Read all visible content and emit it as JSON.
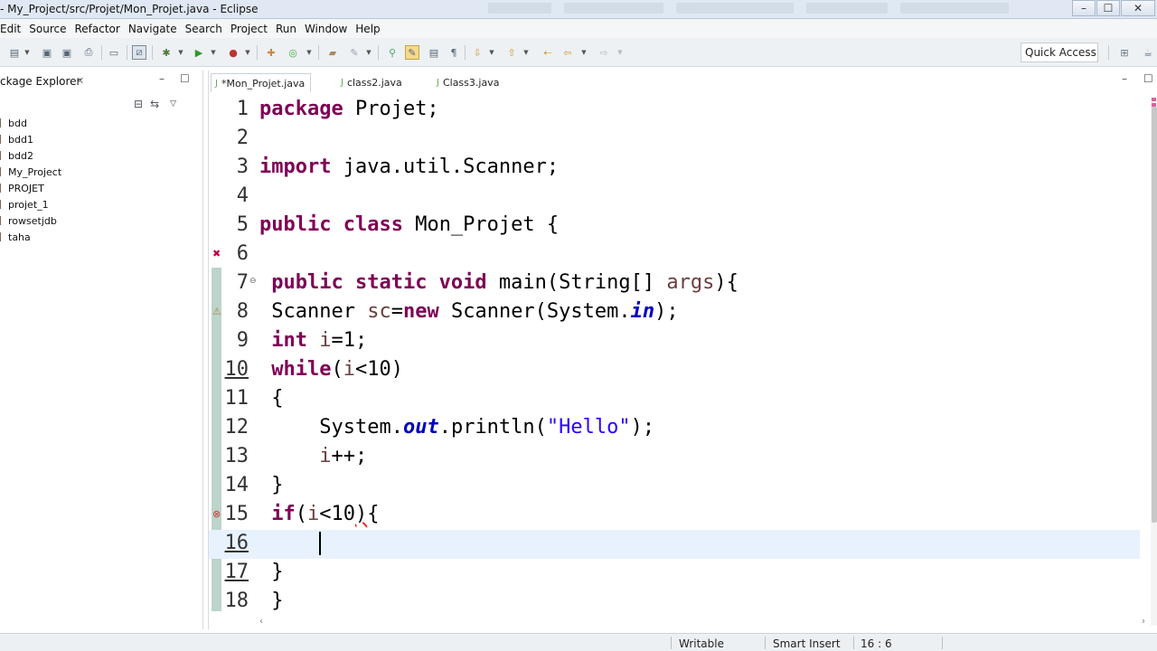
{
  "window": {
    "title": "- My_Project/src/Projet/Mon_Projet.java - Eclipse",
    "buttons": {
      "minimize": "–",
      "maximize": "☐",
      "close": "✕"
    }
  },
  "menu": [
    "Edit",
    "Source",
    "Refactor",
    "Navigate",
    "Search",
    "Project",
    "Run",
    "Window",
    "Help"
  ],
  "toolbar": {
    "quick_access": "Quick Access",
    "icons": [
      "new-icon",
      "save-icon",
      "save-all-icon",
      "print-icon",
      "console-icon",
      "skip-breakpoints-icon",
      "debug-icon",
      "run-icon",
      "external-tools-icon",
      "new-java-project-icon",
      "new-package-icon",
      "new-class-icon",
      "open-type-icon",
      "search-icon",
      "mark-occurrences-icon",
      "block-selection-icon",
      "show-whitespace-icon",
      "next-annotation-icon",
      "previous-annotation-icon",
      "last-edit-icon",
      "back-icon",
      "forward-icon",
      "open-perspective-icon",
      "java-perspective-icon"
    ]
  },
  "package_explorer": {
    "tab_label": "ckage Explorer",
    "close": "✕",
    "minimize": "–",
    "maximize": "☐",
    "projects": [
      "bdd",
      "bdd1",
      "bdd2",
      "My_Project",
      "PROJET",
      "projet_1",
      "rowsetjdb",
      "taha"
    ]
  },
  "editor": {
    "tabs": [
      {
        "label": "*Mon_Projet.java",
        "active": true
      },
      {
        "label": "class2.java",
        "active": false
      },
      {
        "label": "Class3.java",
        "active": false
      }
    ],
    "minimize": "–",
    "maximize": "☐",
    "lines": [
      {
        "n": "1",
        "text": "package Projet;"
      },
      {
        "n": "2",
        "text": ""
      },
      {
        "n": "3",
        "text": "import java.util.Scanner;"
      },
      {
        "n": "4",
        "text": ""
      },
      {
        "n": "5",
        "text": "public class Mon_Projet {"
      },
      {
        "n": "6",
        "text": ""
      },
      {
        "n": "7",
        "text": " public static void main(String[] args){"
      },
      {
        "n": "8",
        "text": " Scanner sc=new Scanner(System.in);"
      },
      {
        "n": "9",
        "text": " int i=1;"
      },
      {
        "n": "10",
        "text": " while(i<10)"
      },
      {
        "n": "11",
        "text": " {"
      },
      {
        "n": "12",
        "text": "     System.out.println(\"Hello\");"
      },
      {
        "n": "13",
        "text": "     i++;"
      },
      {
        "n": "14",
        "text": " }"
      },
      {
        "n": "15",
        "text": " if(i<10){"
      },
      {
        "n": "16",
        "text": "     "
      },
      {
        "n": "17",
        "text": " }"
      },
      {
        "n": "18",
        "text": " }"
      }
    ],
    "current_line": 16
  },
  "status": {
    "writable": "Writable",
    "insert_mode": "Smart Insert",
    "position": "16 : 6"
  },
  "colors": {
    "keyword": "#7f0055",
    "string": "#2a00ff",
    "field": "#0000c0",
    "current_line": "#e8f2fe"
  }
}
